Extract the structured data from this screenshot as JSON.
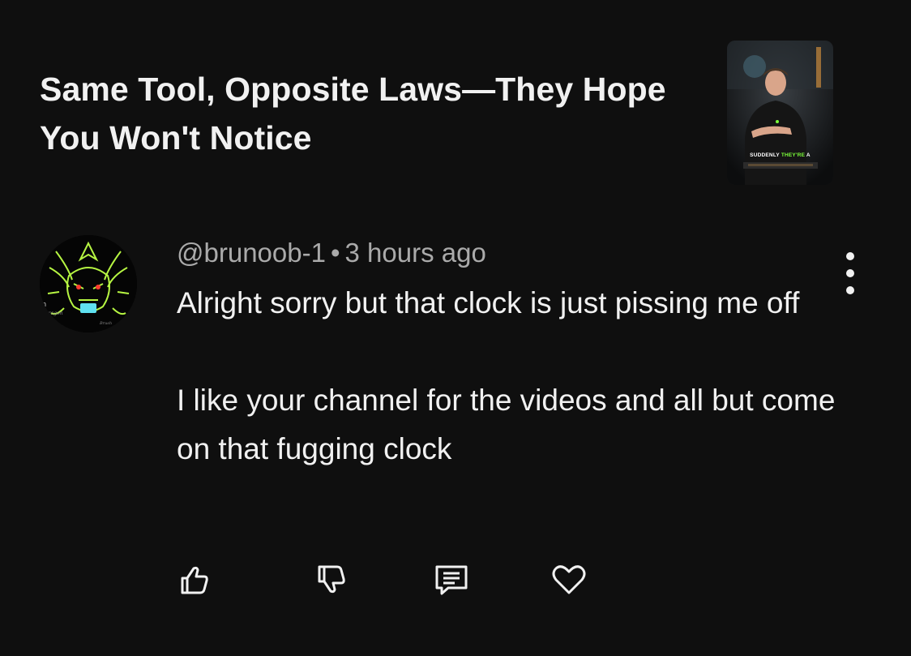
{
  "video": {
    "title": "Same Tool, Opposite Laws—They Hope You Won't Notice",
    "thumbnail": {
      "caption_white": "SUDDENLY",
      "caption_green": "THEY'RE",
      "caption_tail": "A"
    }
  },
  "comment": {
    "author": "@brunoob-1",
    "separator": "•",
    "time": "3 hours ago",
    "paragraphs": [
      "Alright sorry but that clock is just pissing me off",
      "I like your channel for the videos and all but come on that fugging clock"
    ],
    "avatar": {
      "lettering": [
        "in",
        "Dragon",
        "Brush"
      ]
    }
  },
  "actions": [
    {
      "name": "like-button",
      "icon": "thumbs-up-icon"
    },
    {
      "name": "dislike-button",
      "icon": "thumbs-down-icon"
    },
    {
      "name": "reply-button",
      "icon": "comment-icon"
    },
    {
      "name": "heart-button",
      "icon": "heart-icon"
    }
  ],
  "colors": {
    "background": "#0f0f0f",
    "text_primary": "#f1f1f1",
    "text_secondary": "#aaaaaa",
    "accent_green": "#7cff3a"
  }
}
